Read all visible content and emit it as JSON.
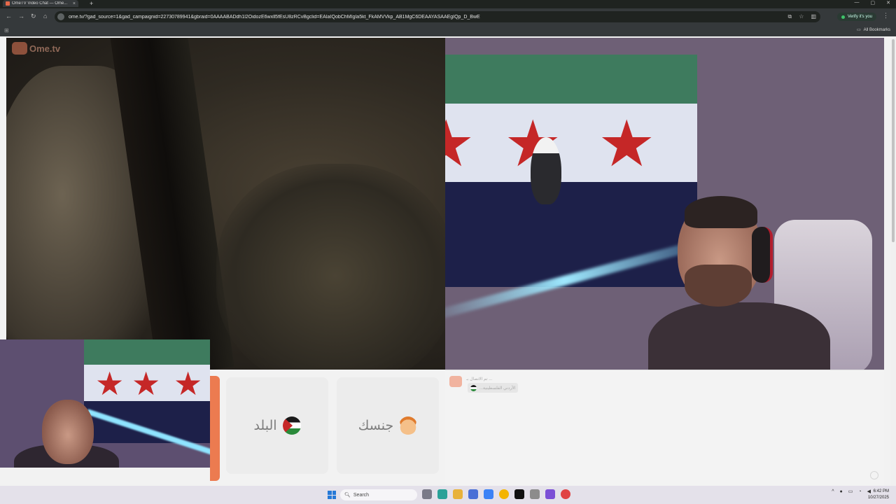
{
  "browser": {
    "tab_title": "OmeTV Video Chat — Ome...",
    "url": "ome.tv/?gad_source=1&gad_campaignid=22730789941&gbraid=0AAAABADdh1l2OidozE6wxll5fEsU8zRCvBgclid=EAIaIQobChMIgIa5kt_FkAMVVkp_AB1MgC6DEAAYASAAEgIQp_D_BwE",
    "verify_label": "Verify it's you",
    "all_bookmarks": "All Bookmarks"
  },
  "page": {
    "logo_text": "Ome.tv",
    "country_filter_label": "البلد",
    "gender_filter_label": "جنسك",
    "chat_message_header": "تم الاتصال بـ ...",
    "chat_message_text": "...الأردني الفلسطينية"
  },
  "taskbar": {
    "search_placeholder": "Search",
    "time": "6:42 PM",
    "date": "10/27/2025"
  },
  "colors": {
    "accent_orange": "#ec7b50",
    "card_bg": "#ececec",
    "flag_green": "#3e7b5e",
    "flag_red_star": "#c52727"
  }
}
